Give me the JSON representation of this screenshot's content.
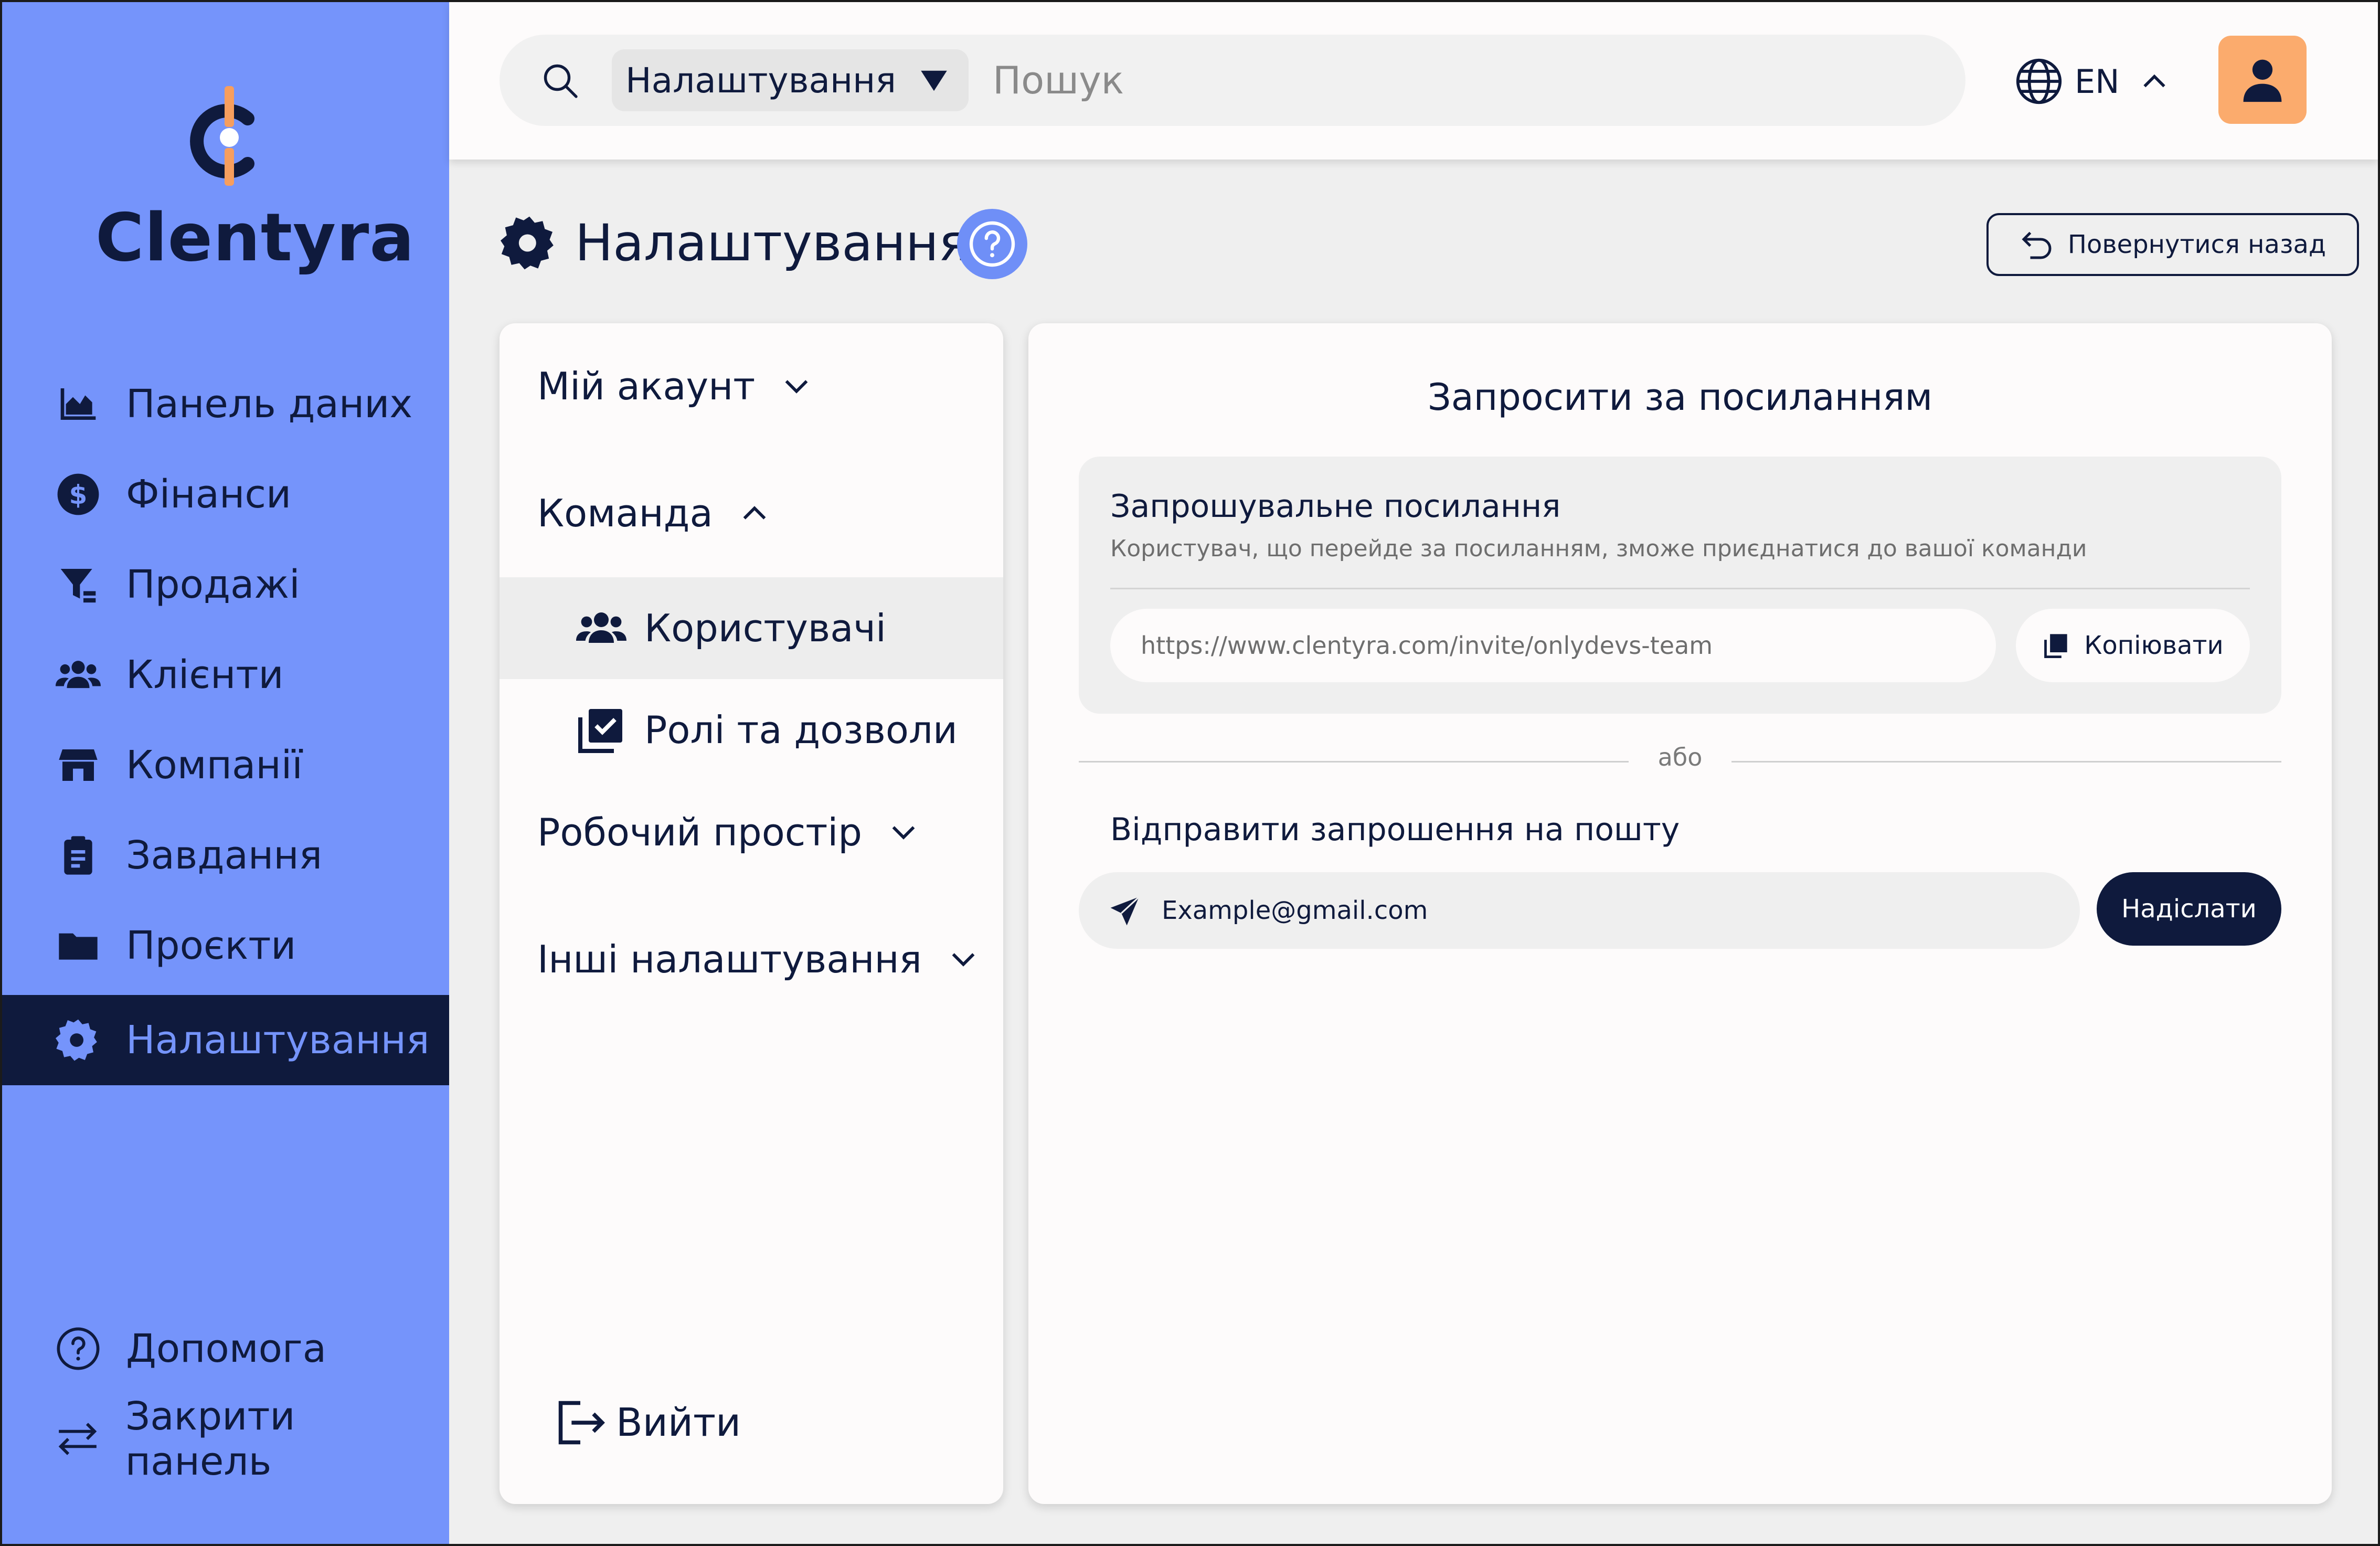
{
  "app": {
    "name": "Clentyra"
  },
  "colors": {
    "sidebar": "#7594fb",
    "navy": "#0f1a3d",
    "accent_orange": "#fbab6d",
    "help_badge": "#6f8ff7"
  },
  "sidebar": {
    "items": [
      {
        "label": "Панель даних",
        "icon": "chart-area-icon"
      },
      {
        "label": "Фінанси",
        "icon": "dollar-circle-icon"
      },
      {
        "label": "Продажі",
        "icon": "funnel-icon"
      },
      {
        "label": "Клієнти",
        "icon": "users-icon"
      },
      {
        "label": "Компанії",
        "icon": "store-icon"
      },
      {
        "label": "Завдання",
        "icon": "clipboard-icon"
      },
      {
        "label": "Проєкти",
        "icon": "folder-icon"
      },
      {
        "label": "Налаштування",
        "icon": "gear-icon",
        "active": true
      }
    ],
    "bottom": [
      {
        "label": "Допомога",
        "icon": "help-circle-icon"
      },
      {
        "label": "Закрити панель",
        "icon": "swap-arrows-icon"
      }
    ]
  },
  "topbar": {
    "scope_label": "Налаштування",
    "search_placeholder": "Пошук",
    "language": "EN"
  },
  "page": {
    "title": "Налаштування",
    "back_label": "Повернутися назад"
  },
  "settings_nav": {
    "my_account": "Мій акаунт",
    "team": "Команда",
    "team_items": [
      {
        "label": "Користувачі",
        "active": true
      },
      {
        "label": "Ролі та дозволи"
      }
    ],
    "workspace": "Робочий простір",
    "other": "Інші налаштування",
    "logout": "Вийти"
  },
  "invite": {
    "title": "Запросити за посиланням",
    "link_section_title": "Запрошувальне посилання",
    "link_section_desc": "Користувач, що перейде за посиланням, зможе приєднатися до вашої команди",
    "link_value": "https://www.clentyra.com/invite/onlydevs-team",
    "copy_label": "Копіювати",
    "or_label": "або",
    "email_title": "Відправити запрошення на пошту",
    "email_placeholder": "Example@gmail.com",
    "send_label": "Надіслати"
  }
}
